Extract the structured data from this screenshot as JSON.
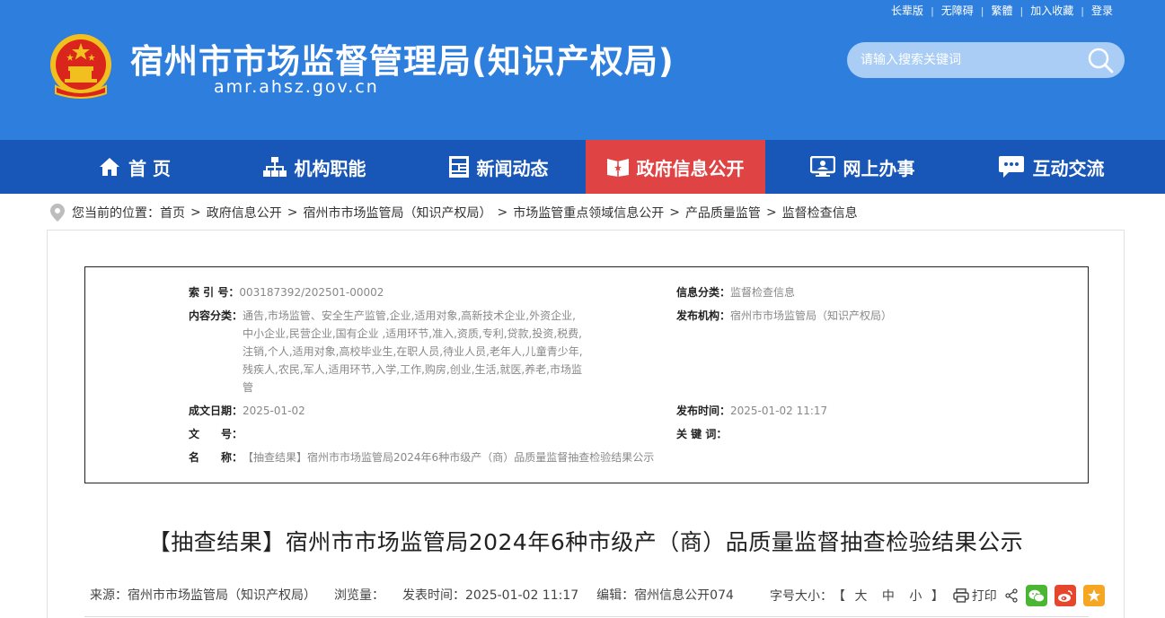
{
  "top_links": [
    "长辈版",
    "无障碍",
    "繁體",
    "加入收藏",
    "登录"
  ],
  "site": {
    "title": "宿州市市场监督管理局(知识产权局)",
    "domain": "amr.ahsz.gov.cn"
  },
  "search": {
    "placeholder": "请输入搜索关键词"
  },
  "nav": [
    {
      "label": "首 页",
      "icon": "home-icon"
    },
    {
      "label": "机构职能",
      "icon": "org-chart-icon"
    },
    {
      "label": "新闻动态",
      "icon": "newspaper-icon"
    },
    {
      "label": "政府信息公开",
      "icon": "open-book-icon",
      "active": true
    },
    {
      "label": "网上办事",
      "icon": "monitor-icon"
    },
    {
      "label": "互动交流",
      "icon": "chat-icon"
    }
  ],
  "breadcrumb": {
    "prefix": "您当前的位置：",
    "items": [
      "首页",
      "政府信息公开",
      "宿州市市场监管局（知识产权局）",
      "市场监管重点领域信息公开",
      "产品质量监管",
      "监督检查信息"
    ]
  },
  "meta": {
    "index_label": "索 引 号：",
    "index_value": "003187392/202501-00002",
    "category_label": "信息分类：",
    "category_value": "监督检查信息",
    "content_label": "内容分类：",
    "content_lines": [
      "通告,市场监管、安全生产监管,企业,适用对象,高新技术企业,外资企业,",
      "中小企业,民营企业,国有企业 ,适用环节,准入,资质,专利,贷款,投资,税费,",
      "注销,个人,适用对象,高校毕业生,在职人员,待业人员,老年人,儿童青少年,",
      "残疾人,农民,军人,适用环节,入学,工作,购房,创业,生活,就医,养老,市场监",
      "管"
    ],
    "publisher_label": "发布机构：",
    "publisher_value": "宿州市市场监管局（知识产权局）",
    "created_label": "成文日期：",
    "created_value": "2025-01-02",
    "published_label": "发布时间：",
    "published_value": "2025-01-02 11:17",
    "docno_label": "文　　号：",
    "docno_value": "",
    "keywords_label": "关 键 词：",
    "keywords_value": "",
    "name_label": "名　　称：",
    "name_value": "【抽查结果】宿州市市场监管局2024年6种市级产（商）品质量监督抽查检验结果公示"
  },
  "article": {
    "title": "【抽查结果】宿州市市场监管局2024年6种市级产（商）品质量监督抽查检验结果公示",
    "source": "来源：宿州市市场监管局（知识产权局）",
    "views": "浏览量：",
    "time": "发表时间：2025-01-02 11:17",
    "editor": "编辑：宿州信息公开074",
    "font_size_label": "字号大小：",
    "font_sizes": [
      "大",
      "中",
      "小"
    ],
    "print_label": "打印"
  },
  "colors": {
    "header_bg": "#2e7fdd",
    "nav_bg": "#1857b8",
    "nav_active": "#e04343",
    "wechat": "#4bb534",
    "weibo": "#e6462c",
    "favorite": "#f5a623"
  }
}
